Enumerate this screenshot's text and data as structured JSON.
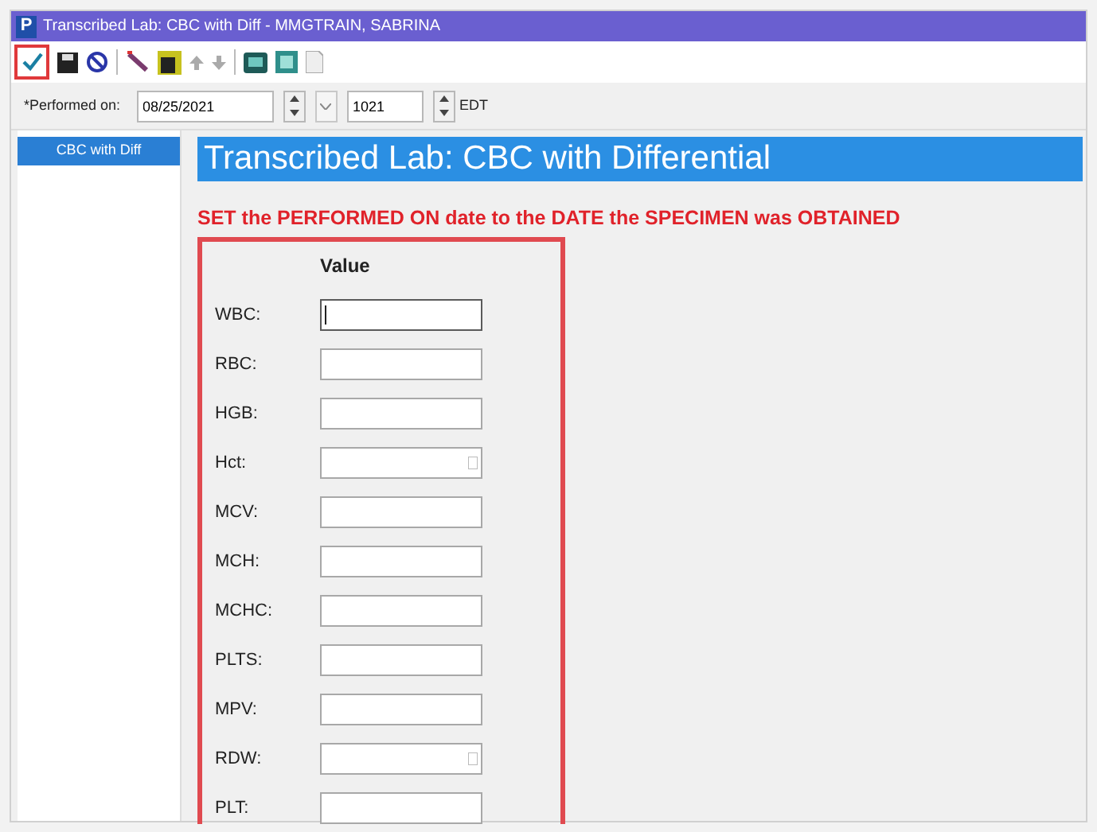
{
  "window": {
    "title": "Transcribed Lab: CBC with Diff - MMGTRAIN, SABRINA",
    "app_letter": "P"
  },
  "toolbar": {
    "highlight_sign": true
  },
  "performed": {
    "label": "*Performed on:",
    "date": "08/25/2021",
    "time": "1021",
    "zone": "EDT"
  },
  "sidebar": {
    "items": [
      {
        "label": "CBC with Diff",
        "selected": true
      }
    ]
  },
  "form": {
    "heading": "Transcribed Lab: CBC with Differential",
    "instruction": "SET the PERFORMED ON date to the DATE the SPECIMEN was OBTAINED",
    "highlighted": true,
    "column": "Value",
    "rows": [
      {
        "label": "WBC:",
        "focused": true,
        "calculated": false
      },
      {
        "label": "RBC:",
        "focused": false,
        "calculated": false
      },
      {
        "label": "HGB:",
        "focused": false,
        "calculated": false
      },
      {
        "label": "Hct:",
        "focused": false,
        "calculated": true
      },
      {
        "label": "MCV:",
        "focused": false,
        "calculated": false
      },
      {
        "label": "MCH:",
        "focused": false,
        "calculated": false
      },
      {
        "label": "MCHC:",
        "focused": false,
        "calculated": false
      },
      {
        "label": "PLTS:",
        "focused": false,
        "calculated": false
      },
      {
        "label": "MPV:",
        "focused": false,
        "calculated": false
      },
      {
        "label": "RDW:",
        "focused": false,
        "calculated": true
      },
      {
        "label": "PLT:",
        "focused": false,
        "calculated": false
      }
    ]
  }
}
